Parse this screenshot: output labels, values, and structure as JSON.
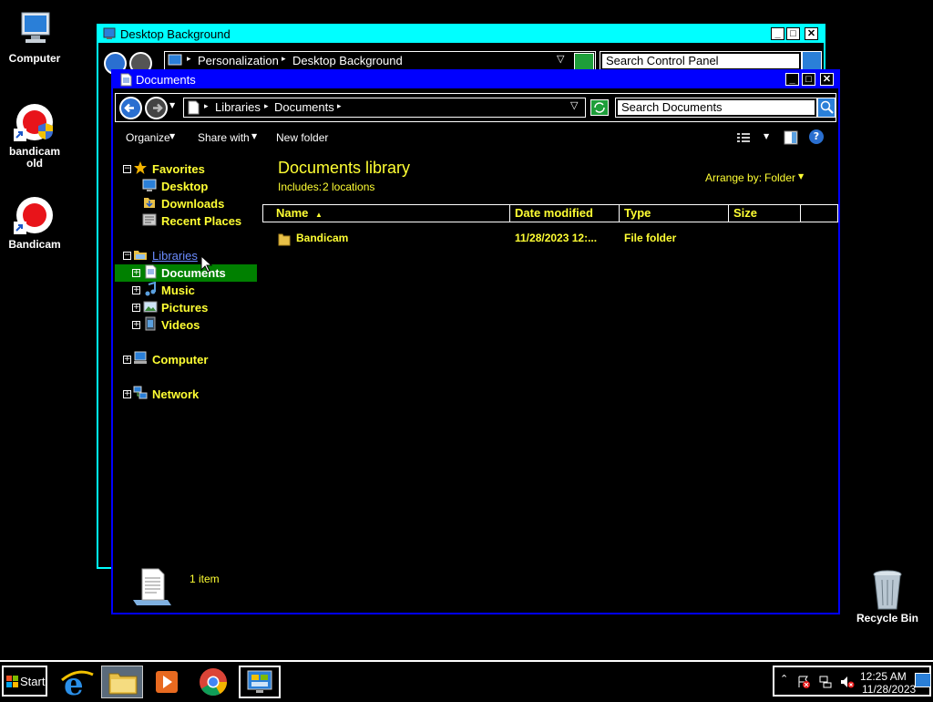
{
  "desktop": {
    "icons": [
      {
        "label": "Computer"
      },
      {
        "label": "bandicam old"
      },
      {
        "label": "Bandicam"
      },
      {
        "label": "Recycle Bin"
      }
    ]
  },
  "back_window": {
    "title": "Desktop Background",
    "breadcrumb": [
      "Personalization",
      "Desktop Background"
    ],
    "search_placeholder": "Search Control Panel"
  },
  "window": {
    "title": "Documents",
    "breadcrumb": [
      "Libraries",
      "Documents"
    ],
    "search_placeholder": "Search Documents",
    "toolbar": {
      "organize": "Organize",
      "share_with": "Share with",
      "new_folder": "New folder"
    },
    "nav": {
      "favorites": "Favorites",
      "favorites_items": [
        "Desktop",
        "Downloads",
        "Recent Places"
      ],
      "libraries": "Libraries",
      "libraries_items": [
        "Documents",
        "Music",
        "Pictures",
        "Videos"
      ],
      "computer": "Computer",
      "network": "Network"
    },
    "library_title": "Documents library",
    "includes_label": "Includes:",
    "includes_link": "2 locations",
    "arrange_label": "Arrange by:",
    "arrange_value": "Folder",
    "columns": [
      "Name",
      "Date modified",
      "Type",
      "Size"
    ],
    "files": [
      {
        "name": "Bandicam",
        "date": "11/28/2023 12:...",
        "type": "File folder",
        "size": ""
      }
    ],
    "status": "1 item"
  },
  "taskbar": {
    "start": "Start",
    "time": "12:25 AM",
    "date": "11/28/2023"
  },
  "colors": {
    "highlight_green": "#008000",
    "title_cyan": "#00ffff",
    "title_blue": "#0000ff",
    "text_yellow": "#ffff33"
  }
}
